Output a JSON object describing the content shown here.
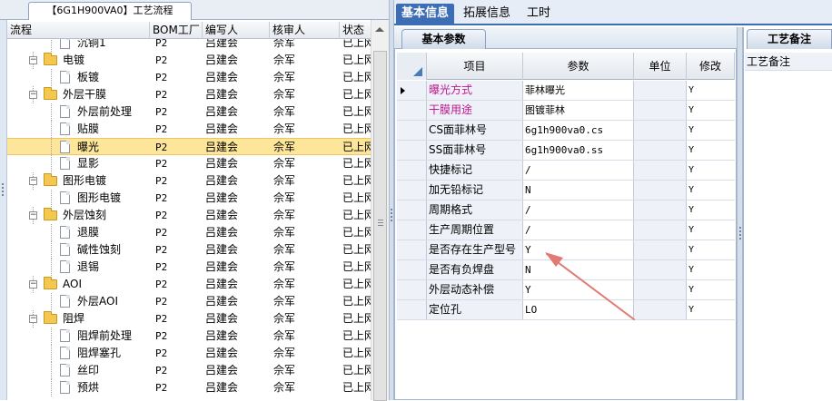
{
  "left_panel": {
    "tab_title": "【6G1H900VA0】工艺流程",
    "columns": [
      "流程",
      "BOM工厂",
      "编写人",
      "核审人",
      "状态"
    ],
    "rows": [
      {
        "name": "沉铜1",
        "level": 2,
        "type": "doc",
        "bom": "P2",
        "author": "吕建会",
        "reviewer": "佘军",
        "status": "已上网"
      },
      {
        "name": "电镀",
        "level": 1,
        "type": "folder",
        "bom": "P2",
        "author": "吕建会",
        "reviewer": "佘军",
        "status": "已上网"
      },
      {
        "name": "板镀",
        "level": 2,
        "type": "doc",
        "bom": "P2",
        "author": "吕建会",
        "reviewer": "佘军",
        "status": "已上网"
      },
      {
        "name": "外层干膜",
        "level": 1,
        "type": "folder",
        "bom": "P2",
        "author": "吕建会",
        "reviewer": "佘军",
        "status": "已上网"
      },
      {
        "name": "外层前处理",
        "level": 2,
        "type": "doc",
        "bom": "P2",
        "author": "吕建会",
        "reviewer": "佘军",
        "status": "已上网"
      },
      {
        "name": "贴膜",
        "level": 2,
        "type": "doc",
        "bom": "P2",
        "author": "吕建会",
        "reviewer": "佘军",
        "status": "已上网"
      },
      {
        "name": "曝光",
        "level": 2,
        "type": "doc",
        "bom": "P2",
        "author": "吕建会",
        "reviewer": "佘军",
        "status": "已上网",
        "selected": true
      },
      {
        "name": "显影",
        "level": 2,
        "type": "doc",
        "bom": "P2",
        "author": "吕建会",
        "reviewer": "佘军",
        "status": "已上网"
      },
      {
        "name": "图形电镀",
        "level": 1,
        "type": "folder",
        "bom": "P2",
        "author": "吕建会",
        "reviewer": "佘军",
        "status": "已上网"
      },
      {
        "name": "图形电镀",
        "level": 2,
        "type": "doc",
        "bom": "P2",
        "author": "吕建会",
        "reviewer": "佘军",
        "status": "已上网"
      },
      {
        "name": "外层蚀刻",
        "level": 1,
        "type": "folder",
        "bom": "P2",
        "author": "吕建会",
        "reviewer": "佘军",
        "status": "已上网"
      },
      {
        "name": "退膜",
        "level": 2,
        "type": "doc",
        "bom": "P2",
        "author": "吕建会",
        "reviewer": "佘军",
        "status": "已上网"
      },
      {
        "name": "碱性蚀刻",
        "level": 2,
        "type": "doc",
        "bom": "P2",
        "author": "吕建会",
        "reviewer": "佘军",
        "status": "已上网"
      },
      {
        "name": "退锡",
        "level": 2,
        "type": "doc",
        "bom": "P2",
        "author": "吕建会",
        "reviewer": "佘军",
        "status": "已上网"
      },
      {
        "name": "AOI",
        "level": 1,
        "type": "folder",
        "bom": "P2",
        "author": "吕建会",
        "reviewer": "佘军",
        "status": "已上网"
      },
      {
        "name": "外层AOI",
        "level": 2,
        "type": "doc",
        "bom": "P2",
        "author": "吕建会",
        "reviewer": "佘军",
        "status": "已上网"
      },
      {
        "name": "阻焊",
        "level": 1,
        "type": "folder",
        "bom": "P2",
        "author": "吕建会",
        "reviewer": "佘军",
        "status": "已上网"
      },
      {
        "name": "阻焊前处理",
        "level": 2,
        "type": "doc",
        "bom": "P2",
        "author": "吕建会",
        "reviewer": "佘军",
        "status": "已上网"
      },
      {
        "name": "阻焊塞孔",
        "level": 2,
        "type": "doc",
        "bom": "P2",
        "author": "吕建会",
        "reviewer": "佘军",
        "status": "已上网"
      },
      {
        "name": "丝印",
        "level": 2,
        "type": "doc",
        "bom": "P2",
        "author": "吕建会",
        "reviewer": "佘军",
        "status": "已上网"
      },
      {
        "name": "预烘",
        "level": 2,
        "type": "doc",
        "bom": "P2",
        "author": "吕建会",
        "reviewer": "佘军",
        "status": "已上网"
      }
    ]
  },
  "main_tabs": [
    {
      "label": "基本信息",
      "active": true
    },
    {
      "label": "拓展信息",
      "active": false
    },
    {
      "label": "工时",
      "active": false
    }
  ],
  "params_panel": {
    "title": "基本参数",
    "columns": [
      "项目",
      "参数",
      "单位",
      "修改"
    ],
    "rows": [
      {
        "item": "曝光方式",
        "value": "菲林曝光",
        "unit": "",
        "modify": "Y",
        "highlight": true,
        "current": true
      },
      {
        "item": "干膜用途",
        "value": "图镀菲林",
        "unit": "",
        "modify": "Y",
        "highlight": true
      },
      {
        "item": "CS面菲林号",
        "value": "6g1h900va0.cs",
        "unit": "",
        "modify": "Y"
      },
      {
        "item": "SS面菲林号",
        "value": "6g1h900va0.ss",
        "unit": "",
        "modify": "Y"
      },
      {
        "item": "快捷标记",
        "value": "/",
        "unit": "",
        "modify": "Y"
      },
      {
        "item": "加无铅标记",
        "value": "N",
        "unit": "",
        "modify": "Y"
      },
      {
        "item": "周期格式",
        "value": "/",
        "unit": "",
        "modify": "Y"
      },
      {
        "item": "生产周期位置",
        "value": "/",
        "unit": "",
        "modify": "Y"
      },
      {
        "item": "是否存在生产型号",
        "value": "Y",
        "unit": "",
        "modify": "Y"
      },
      {
        "item": "是否有负焊盘",
        "value": "N",
        "unit": "",
        "modify": "Y"
      },
      {
        "item": "外层动态补偿",
        "value": "Y",
        "unit": "",
        "modify": "Y"
      },
      {
        "item": "定位孔",
        "value": "LO",
        "unit": "",
        "modify": "Y"
      }
    ]
  },
  "notes_panel": {
    "title": "工艺备注",
    "label": "工艺备注"
  },
  "colors": {
    "highlight_text": "#c0158f",
    "selected_row": "#fde59a",
    "tab_active": "#3d6eb5",
    "annotation_arrow": "#e07a73"
  }
}
